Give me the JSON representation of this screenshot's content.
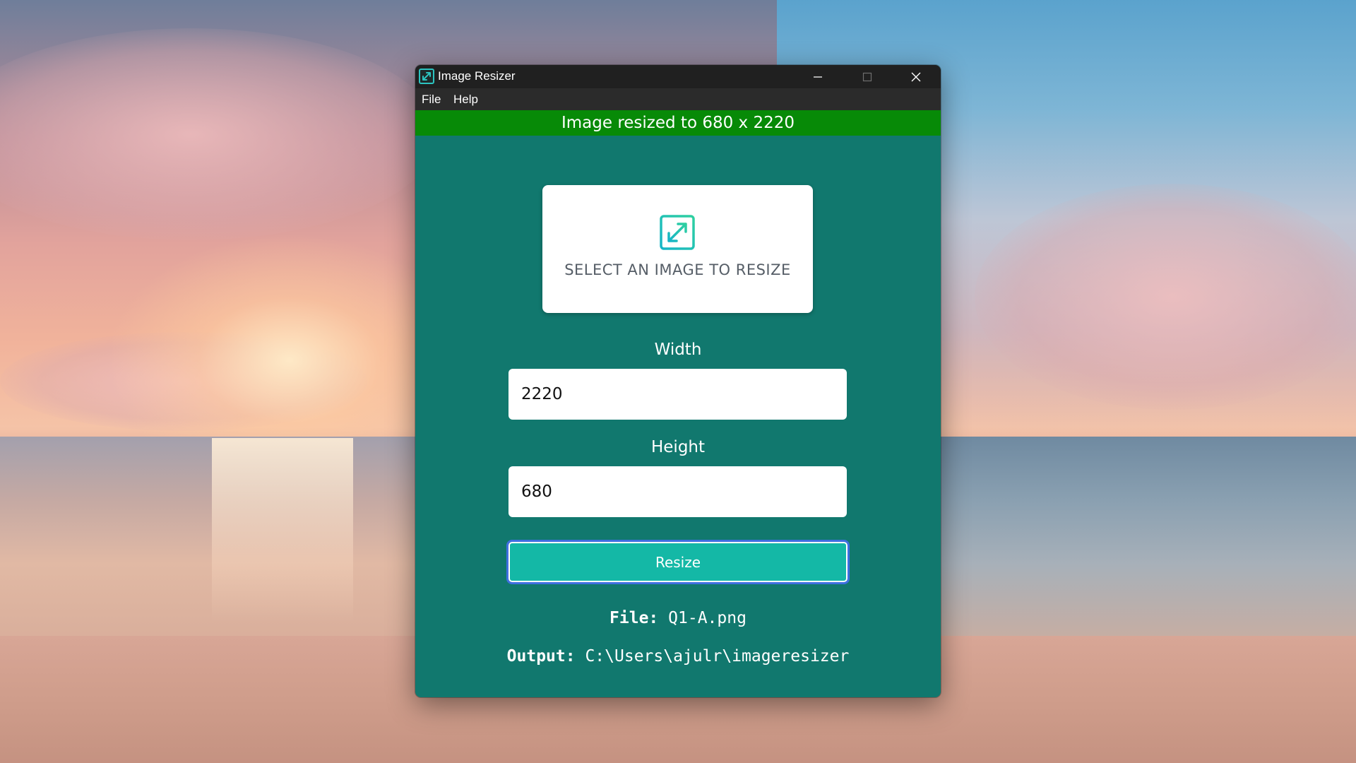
{
  "window": {
    "title": "Image Resizer"
  },
  "menu": {
    "file": "File",
    "help": "Help"
  },
  "status": {
    "message": "Image resized to 680 x 2220",
    "color": "#078a07"
  },
  "select_card": {
    "label": "SELECT AN IMAGE TO RESIZE",
    "icon": "resize-arrows-icon"
  },
  "form": {
    "width_label": "Width",
    "width_value": "2220",
    "height_label": "Height",
    "height_value": "680",
    "resize_label": "Resize"
  },
  "info": {
    "file_key": "File:",
    "file_value": "Q1-A.png",
    "output_key": "Output:",
    "output_value": "C:\\Users\\ajulr\\imageresizer"
  },
  "colors": {
    "window_bg": "#11786e",
    "button_bg": "#14b8a6",
    "button_border": "#3f6fe0",
    "titlebar_bg": "#202020"
  }
}
